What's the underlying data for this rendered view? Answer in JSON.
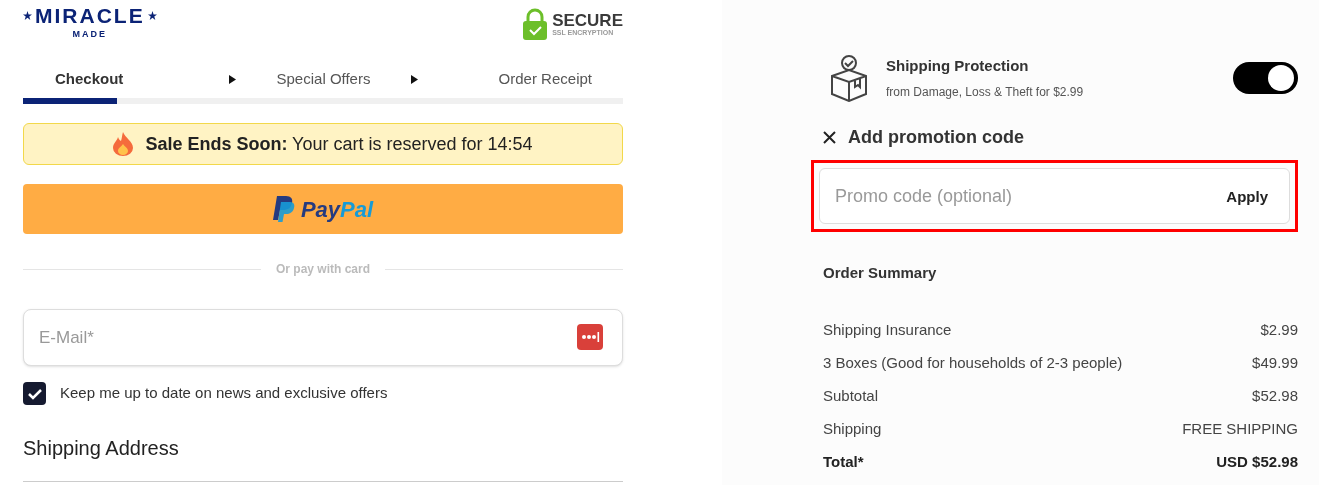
{
  "logo": {
    "name": "MIRACLE",
    "subtitle": "MADE"
  },
  "secure_badge": {
    "title": "SECURE",
    "subtitle": "SSL ENCRYPTION"
  },
  "steps": [
    {
      "label": "Checkout",
      "selected": true
    },
    {
      "label": "Special Offers",
      "selected": false
    },
    {
      "label": "Order Receipt",
      "selected": false
    }
  ],
  "progress": {
    "level": 0.157
  },
  "sale_banner": "**Sale Ends Soon:** Your cart is reserved for 14:54",
  "paypal_button": {
    "label_parts": [
      "Pay",
      "Pal"
    ]
  },
  "divider_text": "Or pay with card",
  "email_field": {
    "placeholder": "E-Mail*"
  },
  "newsletter": {
    "label": "Keep me up to date on news and exclusive offers",
    "checked": true
  },
  "shipping_address_heading": "Shipping Address",
  "shipping_protection": {
    "title": "Shipping Protection",
    "subtitle": "from Damage, Loss & Theft for $2.99",
    "on": true
  },
  "promotion": {
    "toggle_label": "Add promotion code",
    "expanded": true,
    "placeholder": "Promo code (optional)",
    "apply": "Apply"
  },
  "order_summary": {
    "title": "Order Summary",
    "rows": [
      {
        "kind": "line",
        "label": "Shipping Insurance",
        "value": "$2.99"
      },
      {
        "kind": "line",
        "label": "3 Boxes (Good for households of 2-3 people)",
        "value": "$49.99"
      },
      {
        "kind": "line",
        "label": "Subtotal",
        "value": "$52.98"
      },
      {
        "kind": "line",
        "label": "Shipping",
        "value": "FREE SHIPPING"
      },
      {
        "kind": "total",
        "label": "Total*",
        "value": "USD $52.98"
      }
    ]
  }
}
